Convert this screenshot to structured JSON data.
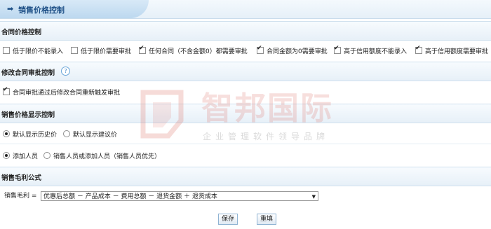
{
  "header": {
    "arrow": "➡",
    "title": "销售价格控制"
  },
  "sections": {
    "contract": {
      "title": "合同价格控制",
      "options": [
        {
          "label": "低于限价不能录入",
          "checked": false
        },
        {
          "label": "低于限价需要审批",
          "checked": false
        },
        {
          "label": "任何合同（不含金额0）都需要审批",
          "checked": true
        },
        {
          "label": "合同金额为0需要审批",
          "checked": true
        },
        {
          "label": "高于信用额度不能录入",
          "checked": true
        },
        {
          "label": "高于信用额度需要审批",
          "checked": true
        }
      ]
    },
    "modify": {
      "title": "修改合同审批控制",
      "help": "?",
      "options": [
        {
          "label": "合同审批通过后修改合同重新触发审批",
          "checked": true
        }
      ]
    },
    "display": {
      "title": "销售价格显示控制",
      "radios1": [
        {
          "label": "默认显示历史价",
          "selected": true
        },
        {
          "label": "默认显示建议价",
          "selected": false
        }
      ],
      "radios2": [
        {
          "label": "添加人员",
          "selected": true
        },
        {
          "label": "销售人员或添加人员（销售人员优先）",
          "selected": false
        }
      ]
    },
    "margin": {
      "title": "销售毛利公式",
      "label": "销售毛利 =",
      "formula": "优惠后总额 － 产品成本 － 费用总额 － 退货金额 ＋ 退货成本"
    }
  },
  "buttons": {
    "save": "保存",
    "reset": "重填"
  },
  "watermark": {
    "name": "智邦国际",
    "tagline": "企业管理软件领导品牌"
  }
}
